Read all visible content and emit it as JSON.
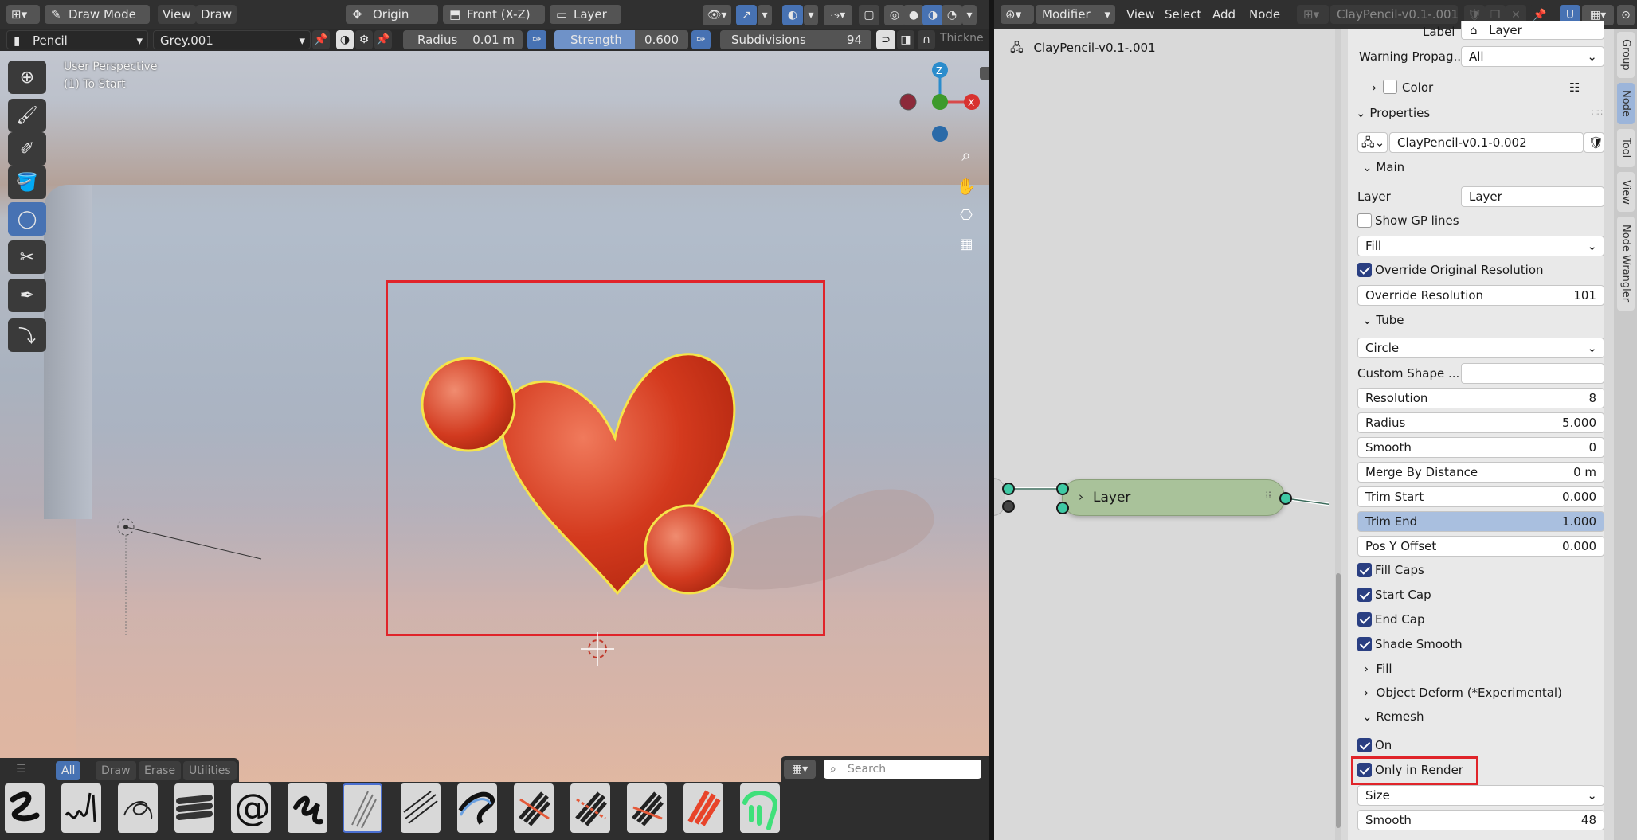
{
  "viewport_header": {
    "mode": "Draw Mode",
    "menus": [
      "View",
      "Draw"
    ],
    "origin": "Origin",
    "projection": "Front (X-Z)",
    "layer": "Layer"
  },
  "tool_header": {
    "brush": "Pencil",
    "material": "Grey.001",
    "radius_label": "Radius",
    "radius_value": "0.01 m",
    "strength_label": "Strength",
    "strength_value": "0.600",
    "subdivisions_label": "Subdivisions",
    "subdivisions_value": "94",
    "thickness_label": "Thickne"
  },
  "viewport": {
    "perspective": "User Perspective",
    "object_info": "(1) To Start",
    "gizmo": {
      "z": "Z",
      "x": "X"
    }
  },
  "asset_shelf": {
    "tabs": [
      "All",
      "Draw",
      "Erase",
      "Utilities"
    ],
    "search_placeholder": "Search"
  },
  "node_header": {
    "editor": "Modifier",
    "menus": [
      "View",
      "Select",
      "Add",
      "Node"
    ],
    "nodetree": "ClayPencil-v0.1-.001"
  },
  "node_editor": {
    "breadcrumb": "ClayPencil-v0.1-.001",
    "node_label": "Layer"
  },
  "sidebar": {
    "label_label": "Label",
    "label_value": "Layer",
    "warning_label": "Warning Propag...",
    "warning_value": "All",
    "color_label": "Color",
    "properties_header": "Properties",
    "nodegroup_name": "ClayPencil-v0.1-0.002",
    "main_header": "Main",
    "layer_label": "Layer",
    "layer_value": "Layer",
    "show_gp_lines": "Show GP lines",
    "fill_mode": "Fill",
    "override_original": "Override Original Resolution",
    "override_resolution_label": "Override  Resolution",
    "override_resolution_value": "101",
    "tube_header": "Tube",
    "tube_shape": "Circle",
    "custom_shape_label": "Custom Shape ...",
    "resolution_label": "Resolution",
    "resolution_value": "8",
    "radius_label": "Radius",
    "radius_value": "5.000",
    "smooth_label": "Smooth",
    "smooth_value": "0",
    "merge_label": "Merge By Distance",
    "merge_value": "0 m",
    "trim_start_label": "Trim Start",
    "trim_start_value": "0.000",
    "trim_end_label": "Trim End",
    "trim_end_value": "1.000",
    "pos_y_label": "Pos Y Offset",
    "pos_y_value": "0.000",
    "fill_caps": "Fill Caps",
    "start_cap": "Start Cap",
    "end_cap": "End Cap",
    "shade_smooth": "Shade Smooth",
    "fill_header": "Fill",
    "object_deform_header": "Object Deform (*Experimental)",
    "remesh_header": "Remesh",
    "on_label": "On",
    "only_in_render": "Only in Render",
    "size_mode": "Size",
    "remesh_smooth_label": "Smooth",
    "remesh_smooth_value": "48"
  },
  "side_tabs": [
    "Group",
    "Node",
    "Tool",
    "View",
    "Node Wrangler"
  ],
  "colors": {
    "accent": "#4772b3",
    "highlight_red": "#e0242a",
    "heart": "#d8391f",
    "node_body": "#a9c29a",
    "socket": "#3fc9a4"
  }
}
